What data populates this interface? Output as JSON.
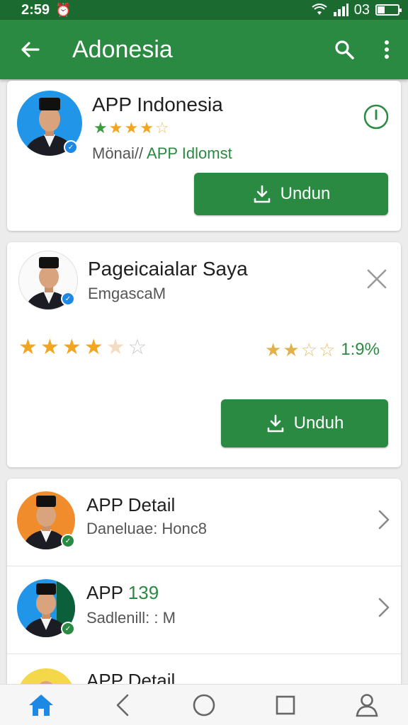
{
  "status_bar": {
    "time": "2:59",
    "battery_text": "03"
  },
  "app_bar": {
    "title": "Adonesia"
  },
  "cards": {
    "first": {
      "title": "APP Indonesia",
      "rating": 4.5,
      "subtitle_prefix": "Mönai//",
      "subtitle_highlight": " APP Idlomst",
      "button_label": "Undun"
    },
    "second": {
      "title": "Pageicaialar Saya",
      "subtitle": "EmgascaM",
      "left_rating": 4.5,
      "right_rating": 2.5,
      "right_value": "1:9%",
      "button_label": "Unduh"
    }
  },
  "list": {
    "items": [
      {
        "title": "APP Detail",
        "title_highlight": "",
        "subtitle": "Daneluae: Honc8"
      },
      {
        "title": "APP",
        "title_highlight": " 139",
        "subtitle": "Sadlenill: : M"
      },
      {
        "title": "APP Detail",
        "title_highlight": "",
        "subtitle": ""
      }
    ]
  },
  "colors": {
    "status_bar": "#1b6b30",
    "app_bar": "#2a8a41",
    "accent_green": "#2a8a41",
    "star": "#f2a51f"
  },
  "icons": {
    "status": [
      "alarm-icon",
      "wifi-icon",
      "signal-icon",
      "battery-icon"
    ],
    "app_bar": [
      "back-arrow-icon",
      "search-icon",
      "more-vert-icon"
    ],
    "nav": [
      "home-icon",
      "back-icon",
      "home-circle-icon",
      "recents-icon",
      "profile-icon"
    ]
  }
}
